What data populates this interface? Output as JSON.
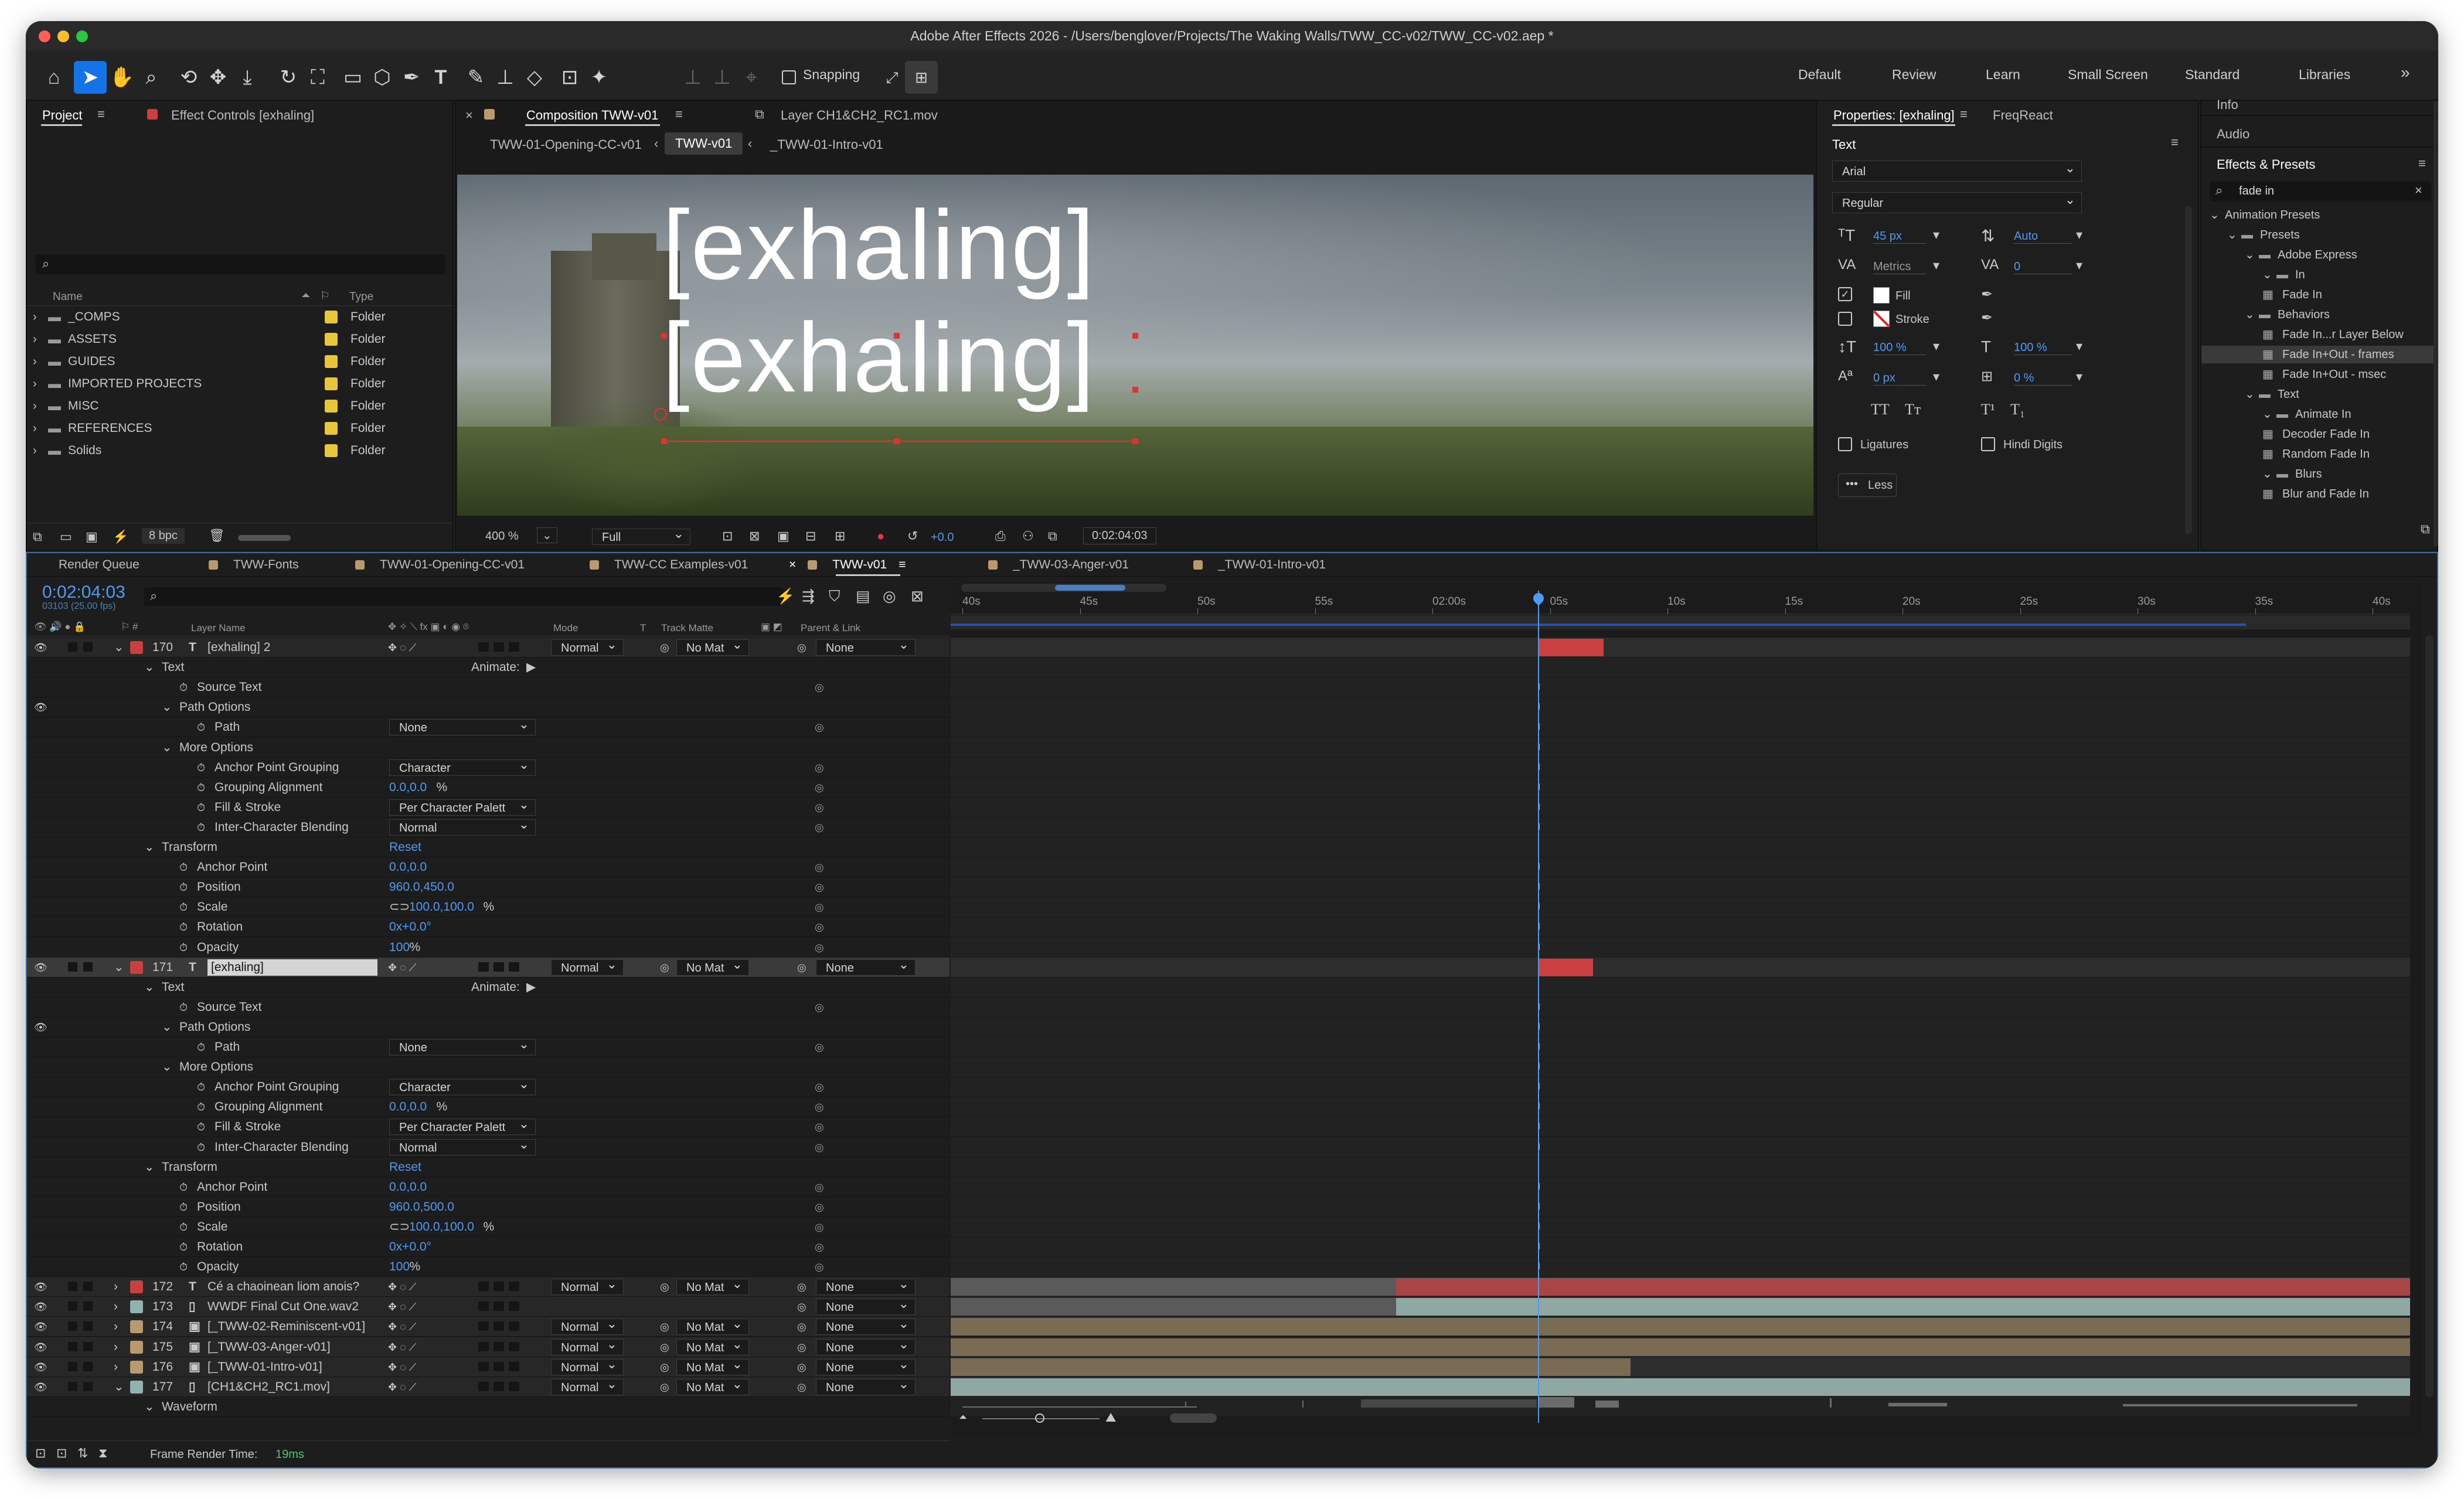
{
  "window": {
    "title": "Adobe After Effects 2026 - /Users/benglover/Projects/The Waking Walls/TWW_CC-v02/TWW_CC-v02.aep *"
  },
  "toolbar": {
    "snapping_label": "Snapping",
    "workspaces": [
      "Default",
      "Review",
      "Learn",
      "Small Screen",
      "Standard",
      "Libraries"
    ],
    "more": "»"
  },
  "project_panel": {
    "tab_project": "Project",
    "tab_effect_controls": "Effect Controls [exhaling]",
    "col_name": "Name",
    "col_type": "Type",
    "items": [
      {
        "name": "_COMPS",
        "type": "Folder"
      },
      {
        "name": "ASSETS",
        "type": "Folder"
      },
      {
        "name": "GUIDES",
        "type": "Folder"
      },
      {
        "name": "IMPORTED PROJECTS",
        "type": "Folder"
      },
      {
        "name": "MISC",
        "type": "Folder"
      },
      {
        "name": "REFERENCES",
        "type": "Folder"
      },
      {
        "name": "Solids",
        "type": "Folder"
      }
    ],
    "bpc": "8 bpc",
    "folder_color": "#e8c53b"
  },
  "comp_panel": {
    "tab_comp": "Composition TWW-v01",
    "tab_layer": "Layer CH1&CH2_RC1.mov",
    "nav": [
      "TWW-01-Opening-CC-v01",
      "TWW-v01",
      "_TWW-01-Intro-v01"
    ],
    "text_top": "[exhaling]",
    "text_bottom": "[exhaling]",
    "zoom": "400 %",
    "resolution": "Full",
    "exposure": "+0.0",
    "timecode": "0:02:04:03"
  },
  "properties": {
    "tab": "Properties: [exhaling]",
    "tab2": "FreqReact",
    "section": "Text",
    "font": "Arial",
    "style": "Regular",
    "size": "45 px",
    "leading": "Auto",
    "kerning": "Metrics",
    "tracking": "0",
    "fill": "Fill",
    "stroke": "Stroke",
    "vscale": "100 %",
    "hscale": "100 %",
    "baseline": "0 px",
    "tsume": "0 %",
    "caps1": "TT",
    "caps2": "Tт",
    "sup": "T¹",
    "sub": "T₁",
    "ligatures": "Ligatures",
    "hindi": "Hindi Digits",
    "less": "Less"
  },
  "effects": {
    "info": "Info",
    "audio": "Audio",
    "title": "Effects & Presets",
    "search": "fade in",
    "tree": [
      {
        "label": "Animation Presets",
        "lvl": 0
      },
      {
        "label": "Presets",
        "lvl": 1
      },
      {
        "label": "Adobe Express",
        "lvl": 2
      },
      {
        "label": "In",
        "lvl": 3
      },
      {
        "label": "Fade In",
        "lvl": 4
      },
      {
        "label": "Behaviors",
        "lvl": 2
      },
      {
        "label": "Fade In...r Layer Below",
        "lvl": 4
      },
      {
        "label": "Fade In+Out - frames",
        "lvl": 4
      },
      {
        "label": "Fade In+Out - msec",
        "lvl": 4
      },
      {
        "label": "Text",
        "lvl": 2
      },
      {
        "label": "Animate In",
        "lvl": 3
      },
      {
        "label": "Decoder Fade In",
        "lvl": 4
      },
      {
        "label": "Random Fade In",
        "lvl": 4
      },
      {
        "label": "Blurs",
        "lvl": 3
      },
      {
        "label": "Blur and Fade In",
        "lvl": 4
      }
    ]
  },
  "timeline": {
    "tabs": [
      "Render Queue",
      "TWW-Fonts",
      "TWW-01-Opening-CC-v01",
      "TWW-CC Examples-v01",
      "TWW-v01",
      "_TWW-03-Anger-v01",
      "_TWW-01-Intro-v01"
    ],
    "timecode": "0:02:04:03",
    "frames": "03103 (25.00 fps)",
    "cols": {
      "layer_name": "Layer Name",
      "mode": "Mode",
      "t": "T",
      "track_matte": "Track Matte",
      "parent": "Parent & Link"
    },
    "ruler": [
      "40s",
      "45s",
      "50s",
      "55s",
      "02:00s",
      "05s",
      "10s",
      "15s",
      "20s",
      "25s",
      "30s",
      "35s",
      "40s"
    ],
    "animate": "Animate:",
    "footer": "Frame Render Time:",
    "render_time": "19ms",
    "rows": [
      {
        "k": "L",
        "n": "170",
        "icon": "T",
        "name": "[exhaling] 2",
        "mode": "Normal",
        "matte": "No Mat",
        "parent": "None",
        "color": "#c94040",
        "expanded": true
      },
      {
        "k": "G",
        "name": "Text",
        "indent": 1
      },
      {
        "k": "P",
        "name": "Source Text",
        "indent": 3
      },
      {
        "k": "G",
        "name": "Path Options",
        "indent": 2
      },
      {
        "k": "P",
        "name": "Path",
        "indent": 4,
        "dd": "None"
      },
      {
        "k": "G",
        "name": "More Options",
        "indent": 2
      },
      {
        "k": "P",
        "name": "Anchor Point Grouping",
        "indent": 4,
        "dd": "Character"
      },
      {
        "k": "P",
        "name": "Grouping Alignment",
        "indent": 4,
        "val": "0.0,0.0",
        "unit": "%"
      },
      {
        "k": "P",
        "name": "Fill & Stroke",
        "indent": 4,
        "dd": "Per Character Palett"
      },
      {
        "k": "P",
        "name": "Inter-Character Blending",
        "indent": 4,
        "dd": "Normal"
      },
      {
        "k": "G",
        "name": "Transform",
        "indent": 1,
        "val": "Reset"
      },
      {
        "k": "P",
        "name": "Anchor Point",
        "indent": 3,
        "val": "0.0,0.0"
      },
      {
        "k": "P",
        "name": "Position",
        "indent": 3,
        "val": "960.0,450.0"
      },
      {
        "k": "P",
        "name": "Scale",
        "indent": 3,
        "val": "100.0,100.0",
        "unit": "%"
      },
      {
        "k": "P",
        "name": "Rotation",
        "indent": 3,
        "val": "0x+0.0°"
      },
      {
        "k": "P",
        "name": "Opacity",
        "indent": 3,
        "val": "100",
        "unit": "%"
      },
      {
        "k": "L",
        "n": "171",
        "icon": "T",
        "name": "[exhaling]",
        "mode": "Normal",
        "matte": "No Mat",
        "parent": "None",
        "color": "#c94040",
        "expanded": true,
        "sel": true
      },
      {
        "k": "G",
        "name": "Text",
        "indent": 1
      },
      {
        "k": "P",
        "name": "Source Text",
        "indent": 3
      },
      {
        "k": "G",
        "name": "Path Options",
        "indent": 2
      },
      {
        "k": "P",
        "name": "Path",
        "indent": 4,
        "dd": "None"
      },
      {
        "k": "G",
        "name": "More Options",
        "indent": 2
      },
      {
        "k": "P",
        "name": "Anchor Point Grouping",
        "indent": 4,
        "dd": "Character"
      },
      {
        "k": "P",
        "name": "Grouping Alignment",
        "indent": 4,
        "val": "0.0,0.0",
        "unit": "%"
      },
      {
        "k": "P",
        "name": "Fill & Stroke",
        "indent": 4,
        "dd": "Per Character Palett"
      },
      {
        "k": "P",
        "name": "Inter-Character Blending",
        "indent": 4,
        "dd": "Normal"
      },
      {
        "k": "G",
        "name": "Transform",
        "indent": 1,
        "val": "Reset"
      },
      {
        "k": "P",
        "name": "Anchor Point",
        "indent": 3,
        "val": "0.0,0.0"
      },
      {
        "k": "P",
        "name": "Position",
        "indent": 3,
        "val": "960.0,500.0"
      },
      {
        "k": "P",
        "name": "Scale",
        "indent": 3,
        "val": "100.0,100.0",
        "unit": "%"
      },
      {
        "k": "P",
        "name": "Rotation",
        "indent": 3,
        "val": "0x+0.0°"
      },
      {
        "k": "P",
        "name": "Opacity",
        "indent": 3,
        "val": "100",
        "unit": "%"
      },
      {
        "k": "L",
        "n": "172",
        "icon": "T",
        "name": "Cé a chaoinean liom anois?",
        "mode": "Normal",
        "matte": "No Mat",
        "parent": "None",
        "color": "#c94040"
      },
      {
        "k": "L",
        "n": "173",
        "icon": "F",
        "name": "WWDF Final Cut One.wav2",
        "mode": "",
        "matte": "",
        "parent": "None",
        "color": "#8fb3b3"
      },
      {
        "k": "L",
        "n": "174",
        "icon": "C",
        "name": "[_TWW-02-Reminiscent-v01]",
        "mode": "Normal",
        "matte": "No Mat",
        "parent": "None",
        "color": "#b89a6e"
      },
      {
        "k": "L",
        "n": "175",
        "icon": "C",
        "name": "[_TWW-03-Anger-v01]",
        "mode": "Normal",
        "matte": "No Mat",
        "parent": "None",
        "color": "#b89a6e"
      },
      {
        "k": "L",
        "n": "176",
        "icon": "C",
        "name": "[_TWW-01-Intro-v01]",
        "mode": "Normal",
        "matte": "No Mat",
        "parent": "None",
        "color": "#b89a6e"
      },
      {
        "k": "L",
        "n": "177",
        "icon": "F",
        "name": "[CH1&CH2_RC1.mov]",
        "mode": "Normal",
        "matte": "No Mat",
        "parent": "None",
        "color": "#8fb3b3",
        "expanded": true
      },
      {
        "k": "G",
        "name": "Waveform",
        "indent": 1
      }
    ]
  }
}
